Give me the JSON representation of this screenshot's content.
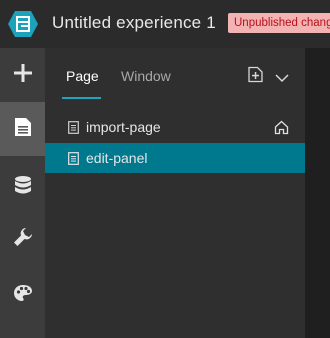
{
  "header": {
    "title": "Untitled experience 1",
    "status_badge": "Unpublished changes"
  },
  "rail": {
    "items": [
      {
        "icon": "plus-icon",
        "active": false
      },
      {
        "icon": "page-icon",
        "active": true
      },
      {
        "icon": "database-icon",
        "active": false
      },
      {
        "icon": "wrench-icon",
        "active": false
      },
      {
        "icon": "palette-icon",
        "active": false
      }
    ]
  },
  "panel": {
    "tabs": [
      {
        "label": "Page",
        "active": true
      },
      {
        "label": "Window",
        "active": false
      }
    ],
    "pages": [
      {
        "label": "import-page",
        "home": true,
        "selected": false
      },
      {
        "label": "edit-panel",
        "home": false,
        "selected": true
      }
    ]
  },
  "colors": {
    "accent": "#1ba6bd",
    "selected_row": "#00788e",
    "badge_bg": "#f4b3b3",
    "badge_text": "#b8101a"
  }
}
